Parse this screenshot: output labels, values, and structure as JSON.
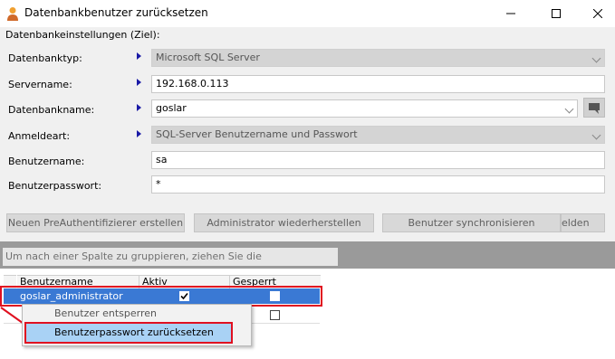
{
  "window": {
    "title": "Datenbankbenutzer zurücksetzen"
  },
  "group": {
    "label": "Datenbankeinstellungen (Ziel):"
  },
  "form": {
    "db_type": {
      "label": "Datenbanktyp:",
      "value": "Microsoft SQL Server"
    },
    "server_name": {
      "label": "Servername:",
      "value": "192.168.0.113"
    },
    "db_name": {
      "label": "Datenbankname:",
      "value": "goslar"
    },
    "auth_type": {
      "label": "Anmeldeart:",
      "value": "SQL-Server Benutzername und Passwort"
    },
    "username": {
      "label": "Benutzername:",
      "value": "sa"
    },
    "password": {
      "label": "Benutzerpasswort:",
      "value": "*"
    }
  },
  "buttons": {
    "new_preauth": "Neuen PreAuthentifizierer erstellen",
    "restore_admin": "Administrator wiederherstellen",
    "sync_users": "Benutzer synchronisieren",
    "partial": "elden"
  },
  "grid": {
    "group_hint": "Um nach einer Spalte zu gruppieren, ziehen Sie die Spaltenkopfzeile hierher.",
    "columns": [
      "Benutzername",
      "Aktiv",
      "Gesperrt"
    ],
    "rows": [
      {
        "username": "goslar_administrator",
        "active": true,
        "locked": false
      },
      {
        "username": "",
        "active": false,
        "locked": false
      }
    ]
  },
  "context_menu": {
    "items": [
      "Benutzer entsperren",
      "Benutzerpasswort zurücksetzen"
    ]
  },
  "colors": {
    "highlight_border": "#e01020",
    "selection": "#3a79d4",
    "menu_highlight": "#a9d2f5"
  }
}
